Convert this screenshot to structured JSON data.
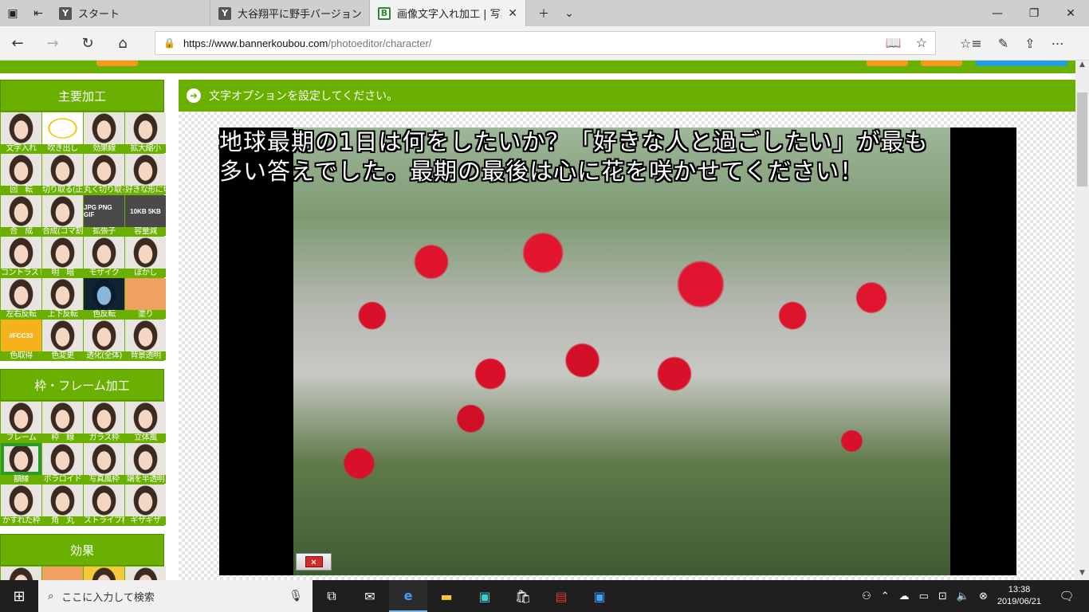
{
  "browser": {
    "tabs": [
      {
        "title": "スタート",
        "favicon": "Y"
      },
      {
        "title": "大谷翔平に野手バージョン「オー",
        "favicon": "Y"
      },
      {
        "title": "画像文字入れ加工 | 写真",
        "favicon": "B"
      }
    ],
    "url_host": "https://www.bannerkoubou.com",
    "url_path": "/photoeditor/character/"
  },
  "sidebar": {
    "sections": [
      {
        "title": "主要加工",
        "items": [
          "文字入れ",
          "吹き出し",
          "効果線",
          "拡大縮小",
          "回　転",
          "切り取る(正方)",
          "丸く切り取る",
          "好きな形に切り取る",
          "合　成",
          "合成(コマ割)",
          "拡張子",
          "容量減",
          "コントラスト",
          "明　暗",
          "モザイク",
          "ぼかし",
          "左右反転",
          "上下反転",
          "色反転",
          "塗り",
          "色取得",
          "色変更",
          "透化(全体)",
          "背景透明"
        ]
      },
      {
        "title": "枠・フレーム加工",
        "items": [
          "フレーム",
          "枠　線",
          "ガラス枠",
          "立体風",
          "額縁",
          "ポラロイド",
          "写真風枠",
          "端を半透明",
          "かすれた枠",
          "角　丸",
          "ストライプ枠",
          "ギザギザ"
        ]
      },
      {
        "title": "効果",
        "items": []
      }
    ],
    "tile_texts": {
      "ext_tile": "JPG PNG GIF",
      "size_tile": "10KB 5KB",
      "color_tile": "#FCC33"
    }
  },
  "main": {
    "instruction": "文字オプションを設定してください。",
    "caption": "地球最期の1日は何をしたいか？「好きな人と過ごしたい」が最も多い答えでした。最期の最後は心に花を咲かせてください！",
    "close_label": "×"
  },
  "taskbar": {
    "search_placeholder": "ここに入力して検索",
    "time": "13:38",
    "date": "2019/06/21"
  },
  "colors": {
    "accent_green": "#6ab000",
    "orange": "#f39a1b",
    "blue": "#1e9ee0"
  }
}
